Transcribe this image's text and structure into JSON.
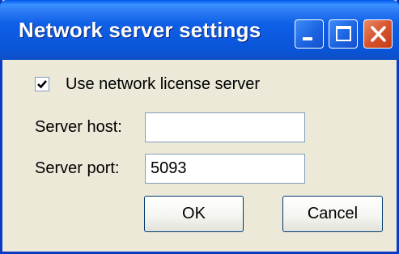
{
  "window": {
    "title": "Network server settings",
    "controls": {
      "minimize_icon": "minimize-icon",
      "maximize_icon": "maximize-icon",
      "close_icon": "close-icon"
    }
  },
  "form": {
    "use_network_license": {
      "label": "Use network license server",
      "checked": true
    },
    "server_host": {
      "label": "Server host:",
      "value": ""
    },
    "server_port": {
      "label": "Server port:",
      "value": "5093"
    }
  },
  "buttons": {
    "ok_label": "OK",
    "cancel_label": "Cancel"
  },
  "colors": {
    "title_bar": "#0a54d6",
    "close_button": "#d6542e",
    "dialog_background": "#ece9d8"
  }
}
